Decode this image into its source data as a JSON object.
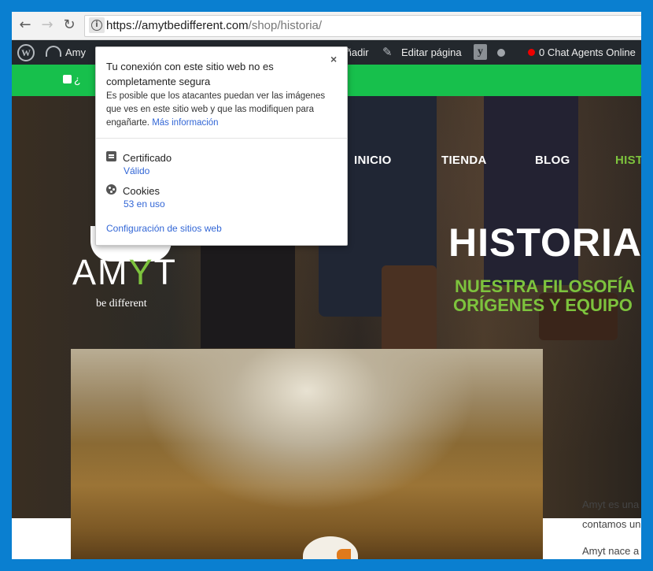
{
  "browser": {
    "url_host": "https://amytbedifferent.com",
    "url_path": "/shop/historia/",
    "back_glyph": "←",
    "forward_glyph": "→",
    "reload_glyph": "↻",
    "info_glyph": "i"
  },
  "admin_bar": {
    "site_label": "Amy",
    "add_label": "Añadir",
    "edit_label": "Editar página",
    "chat_label": "0 Chat Agents Online",
    "wp_glyph": "W",
    "yoast_glyph": "y",
    "edit_glyph": "✎"
  },
  "green_bar": {
    "text": "¿"
  },
  "site_nav": {
    "items": [
      "INICIO",
      "TIENDA",
      "BLOG",
      "HIST"
    ]
  },
  "hero": {
    "title": "HISTORIA",
    "subtitle_line1": "NUESTRA FILOSOFÍA",
    "subtitle_line2": "ORÍGENES Y EQUIPO"
  },
  "logo": {
    "text_a": "AM",
    "text_y": "Y",
    "text_t": "T",
    "tagline": "be different"
  },
  "content": {
    "line1": "Amyt es una",
    "line2": "contamos un",
    "line3": "Amyt nace a"
  },
  "security_popup": {
    "title": "Tu conexión con este sitio web no es completamente segura",
    "close_glyph": "×",
    "description": "Es posible que los atacantes puedan ver las imágenes que ves en este sitio web y que las modifiquen para engañarte.",
    "learn_more": "Más información",
    "certificate_label": "Certificado",
    "certificate_status": "Válido",
    "cookies_label": "Cookies",
    "cookies_status": "53 en uso",
    "settings_link": "Configuración de sitios web"
  },
  "colors": {
    "frame_border": "#0a7fd0",
    "accent_green": "#17c04c",
    "hero_green": "#7dc33d",
    "link_blue": "#3367d6"
  }
}
